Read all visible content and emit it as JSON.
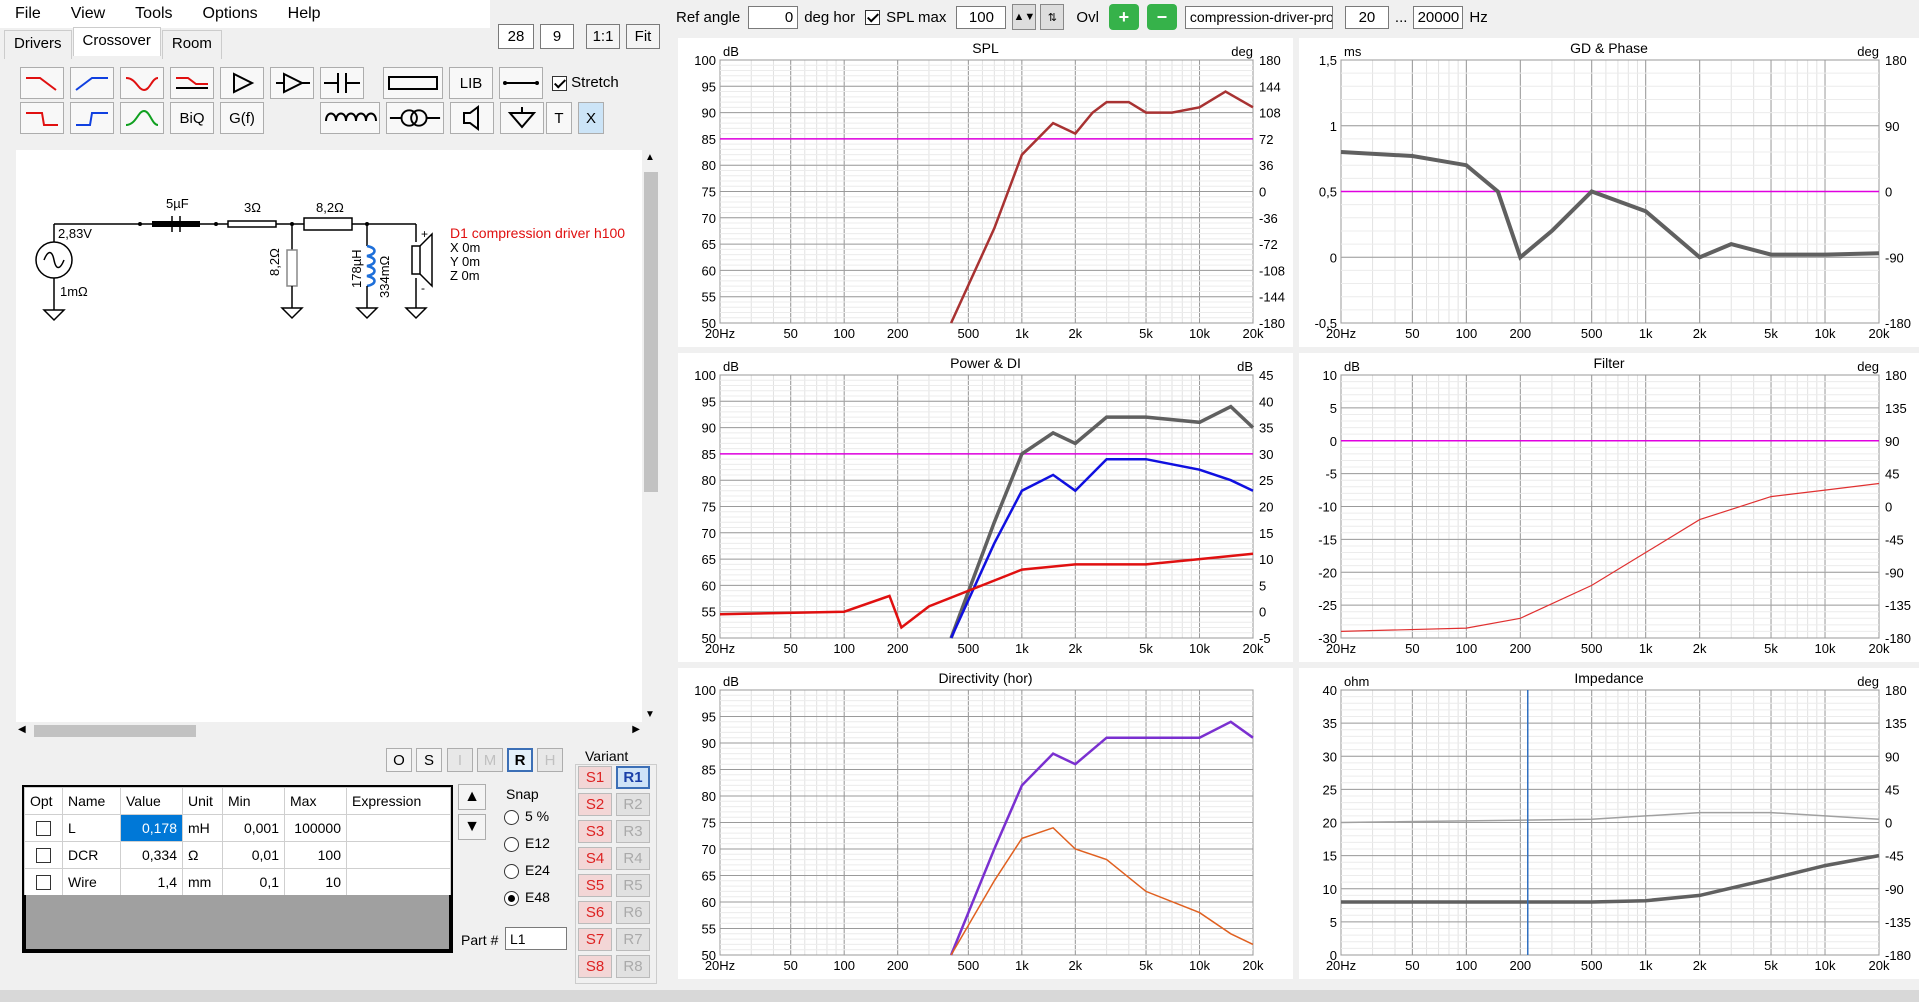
{
  "menu": [
    "File",
    "View",
    "Tools",
    "Options",
    "Help"
  ],
  "tabs": [
    "Drivers",
    "Crossover",
    "Room"
  ],
  "zoom": {
    "a": "28",
    "b": "9",
    "ratio": "1:1",
    "fit": "Fit"
  },
  "toolbar": {
    "lib": "LIB",
    "biq": "BiQ",
    "gf": "G(f)",
    "t": "T",
    "x": "X",
    "stretch": "Stretch"
  },
  "schematic": {
    "source_v": "2,83V",
    "source_r": "1mΩ",
    "c1": "5µF",
    "r1": "3Ω",
    "r2": "8,2Ω",
    "r3": "8,2Ω",
    "l1": "178µH",
    "l1r": "334mΩ",
    "driver": "D1 compression driver h100",
    "x": "X 0m",
    "y": "Y 0m",
    "z": "Z 0m"
  },
  "sel_buttons": [
    "O",
    "S",
    "I",
    "M",
    "R",
    "H"
  ],
  "table": {
    "headers": [
      "Opt",
      "Name",
      "Value",
      "Unit",
      "Min",
      "Max",
      "Expression"
    ],
    "rows": [
      {
        "name": "L",
        "value": "0,178",
        "unit": "mH",
        "min": "0,001",
        "max": "100000",
        "expr": ""
      },
      {
        "name": "DCR",
        "value": "0,334",
        "unit": "Ω",
        "min": "0,01",
        "max": "100",
        "expr": ""
      },
      {
        "name": "Wire",
        "value": "1,4",
        "unit": "mm",
        "min": "0,1",
        "max": "10",
        "expr": ""
      }
    ]
  },
  "snap": {
    "label": "Snap",
    "options": [
      "5 %",
      "E12",
      "E24",
      "E48"
    ],
    "selected": "E48"
  },
  "part": {
    "label": "Part #",
    "value": "L1"
  },
  "variant": {
    "label": "Variant",
    "s": [
      "S1",
      "S2",
      "S3",
      "S4",
      "S5",
      "S6",
      "S7",
      "S8"
    ],
    "r": [
      "R1",
      "R2",
      "R3",
      "R4",
      "R5",
      "R6",
      "R7",
      "R8"
    ]
  },
  "top": {
    "ref_angle_label": "Ref angle",
    "ref_angle": "0",
    "deg_hor": "deg hor",
    "spl_max_label": "SPL max",
    "spl_max": "100",
    "ovl": "Ovl",
    "file": "compression-driver-prote",
    "fmin": "20",
    "dots": "...",
    "fmax": "20000",
    "hz": "Hz"
  },
  "x_ticks": [
    "20Hz",
    "50",
    "100",
    "200",
    "500",
    "1k",
    "2k",
    "5k",
    "10k",
    "20k"
  ],
  "plots": {
    "spl": {
      "title": "SPL",
      "ul": "dB",
      "ur": "deg",
      "left": [
        "100",
        "95",
        "90",
        "85",
        "80",
        "75",
        "70",
        "65",
        "60",
        "55",
        "50"
      ],
      "right": [
        "180",
        "144",
        "108",
        "72",
        "36",
        "0",
        "-36",
        "-72",
        "-108",
        "-144",
        "-180"
      ]
    },
    "gd": {
      "title": "GD & Phase",
      "ul": "ms",
      "ur": "deg",
      "left": [
        "1,5",
        "1",
        "0,5",
        "0",
        "-0,5"
      ],
      "right": [
        "180",
        "90",
        "0",
        "-90",
        "-180"
      ]
    },
    "power": {
      "title": "Power & DI",
      "ul": "dB",
      "ur": "dB",
      "left": [
        "100",
        "95",
        "90",
        "85",
        "80",
        "75",
        "70",
        "65",
        "60",
        "55",
        "50"
      ],
      "right": [
        "45",
        "40",
        "35",
        "30",
        "25",
        "20",
        "15",
        "10",
        "5",
        "0",
        "-5"
      ]
    },
    "filter": {
      "title": "Filter",
      "ul": "dB",
      "ur": "deg",
      "left": [
        "10",
        "5",
        "0",
        "-5",
        "-10",
        "-15",
        "-20",
        "-25",
        "-30"
      ],
      "right": [
        "180",
        "135",
        "90",
        "45",
        "0",
        "-45",
        "-90",
        "-135",
        "-180"
      ]
    },
    "dir": {
      "title": "Directivity (hor)",
      "ul": "dB",
      "left": [
        "100",
        "95",
        "90",
        "85",
        "80",
        "75",
        "70",
        "65",
        "60",
        "55",
        "50"
      ]
    },
    "imp": {
      "title": "Impedance",
      "ul": "ohm",
      "ur": "deg",
      "left": [
        "40",
        "35",
        "30",
        "25",
        "20",
        "15",
        "10",
        "5",
        "0"
      ],
      "right": [
        "180",
        "135",
        "90",
        "45",
        "0",
        "-45",
        "-90",
        "-135",
        "-180"
      ]
    }
  },
  "chart_data": [
    {
      "type": "line",
      "title": "SPL",
      "xlabel": "Hz",
      "ylabel": "dB",
      "x_scale": "log",
      "xlim": [
        20,
        20000
      ],
      "ylim": [
        50,
        100
      ],
      "series": [
        {
          "x": [
            400,
            700,
            1000,
            1500,
            2000,
            2500,
            3000,
            4000,
            5000,
            7000,
            10000,
            14000,
            20000
          ],
          "values": [
            50,
            68,
            82,
            88,
            86,
            90,
            92,
            92,
            90,
            90,
            91,
            94,
            91
          ]
        }
      ],
      "reference_line": 85
    },
    {
      "type": "line",
      "title": "GD & Phase",
      "xlabel": "Hz",
      "ylabel": "ms",
      "x_scale": "log",
      "xlim": [
        20,
        20000
      ],
      "ylim": [
        -0.5,
        1.5
      ],
      "series": [
        {
          "x": [
            20,
            50,
            100,
            150,
            200,
            300,
            500,
            1000,
            2000,
            3000,
            5000,
            10000,
            20000
          ],
          "values": [
            0.8,
            0.77,
            0.7,
            0.5,
            0.0,
            0.2,
            0.5,
            0.35,
            0.0,
            0.1,
            0.02,
            0.02,
            0.03
          ]
        }
      ],
      "reference_line": 0.5
    },
    {
      "type": "line",
      "title": "Power & DI",
      "xlabel": "Hz",
      "ylabel": "dB",
      "x_scale": "log",
      "xlim": [
        20,
        20000
      ],
      "ylim": [
        50,
        100
      ],
      "series": [
        {
          "x": [
            400,
            700,
            1000,
            1500,
            2000,
            3000,
            5000,
            10000,
            15000,
            20000
          ],
          "values": [
            50,
            72,
            85,
            89,
            87,
            92,
            92,
            91,
            94,
            90
          ]
        },
        {
          "x": [
            400,
            700,
            1000,
            1500,
            2000,
            3000,
            5000,
            10000,
            15000,
            20000
          ],
          "values": [
            50,
            68,
            78,
            81,
            78,
            84,
            84,
            82,
            80,
            78
          ]
        },
        {
          "x": [
            20,
            100,
            180,
            210,
            300,
            1000,
            2000,
            5000,
            10000,
            20000
          ],
          "values": [
            54.5,
            55,
            58,
            52,
            56,
            63,
            64,
            64,
            65,
            66
          ]
        }
      ],
      "reference_line": 85
    },
    {
      "type": "line",
      "title": "Filter",
      "xlabel": "Hz",
      "ylabel": "dB",
      "x_scale": "log",
      "xlim": [
        20,
        20000
      ],
      "ylim": [
        -30,
        10
      ],
      "series": [
        {
          "x": [
            20,
            100,
            200,
            500,
            1000,
            2000,
            5000,
            10000,
            20000
          ],
          "values": [
            -29,
            -28.5,
            -27,
            -22,
            -17,
            -12,
            -8.5,
            -7.5,
            -6.5
          ]
        }
      ],
      "reference_line": 0
    },
    {
      "type": "line",
      "title": "Directivity (hor)",
      "xlabel": "Hz",
      "ylabel": "dB",
      "x_scale": "log",
      "xlim": [
        20,
        20000
      ],
      "ylim": [
        50,
        100
      ],
      "series": [
        {
          "x": [
            400,
            700,
            1000,
            1500,
            2000,
            3000,
            5000,
            10000,
            15000,
            20000
          ],
          "values": [
            50,
            70,
            82,
            88,
            86,
            91,
            91,
            91,
            94,
            91
          ]
        },
        {
          "x": [
            400,
            700,
            1000,
            1500,
            2000,
            3000,
            5000,
            10000,
            15000,
            20000
          ],
          "values": [
            50,
            64,
            72,
            74,
            70,
            68,
            62,
            58,
            54,
            52
          ]
        }
      ]
    },
    {
      "type": "line",
      "title": "Impedance",
      "xlabel": "Hz",
      "ylabel": "ohm",
      "x_scale": "log",
      "xlim": [
        20,
        20000
      ],
      "ylim": [
        0,
        40
      ],
      "series": [
        {
          "x": [
            20,
            200,
            500,
            1000,
            2000,
            5000,
            10000,
            20000
          ],
          "values": [
            8,
            8,
            8,
            8.2,
            9,
            11.5,
            13.5,
            15
          ]
        },
        {
          "x": [
            20,
            500,
            1000,
            2000,
            5000,
            10000,
            20000
          ],
          "values": [
            20,
            20.5,
            21,
            21.5,
            21.5,
            21,
            20.5
          ]
        }
      ]
    }
  ]
}
